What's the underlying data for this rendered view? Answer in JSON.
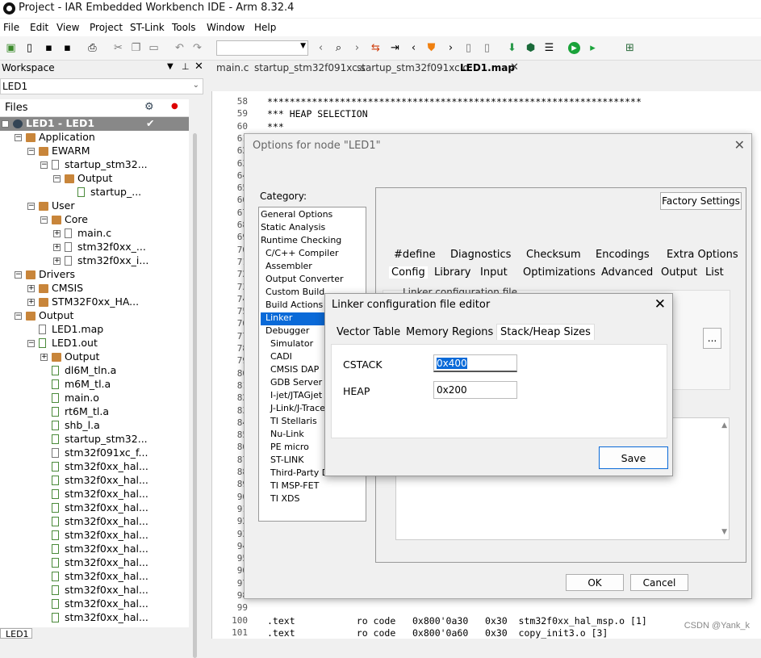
{
  "app": {
    "title": "Project - IAR Embedded Workbench IDE - Arm 8.32.4"
  },
  "menu": [
    "File",
    "Edit",
    "View",
    "Project",
    "ST-Link",
    "Tools",
    "Window",
    "Help"
  ],
  "workspace": {
    "header": "Workspace",
    "combo": "LED1",
    "files_header": "Files",
    "bottom_tab": "LED1",
    "tree": [
      {
        "label": "LED1 - LED1",
        "depth": 0,
        "kind": "project",
        "exp": "−"
      },
      {
        "label": "Application",
        "depth": 1,
        "kind": "folder",
        "exp": "−"
      },
      {
        "label": "EWARM",
        "depth": 2,
        "kind": "folder",
        "exp": "−"
      },
      {
        "label": "startup_stm32...",
        "depth": 3,
        "kind": "filegray",
        "exp": "−"
      },
      {
        "label": "Output",
        "depth": 4,
        "kind": "folder",
        "exp": "−"
      },
      {
        "label": "startup_...",
        "depth": 5,
        "kind": "file",
        "exp": ""
      },
      {
        "label": "User",
        "depth": 2,
        "kind": "folder",
        "exp": "−"
      },
      {
        "label": "Core",
        "depth": 3,
        "kind": "folder",
        "exp": "−"
      },
      {
        "label": "main.c",
        "depth": 4,
        "kind": "filegray",
        "exp": "+"
      },
      {
        "label": "stm32f0xx_...",
        "depth": 4,
        "kind": "filegray",
        "exp": "+"
      },
      {
        "label": "stm32f0xx_i...",
        "depth": 4,
        "kind": "filegray",
        "exp": "+"
      },
      {
        "label": "Drivers",
        "depth": 1,
        "kind": "folder",
        "exp": "−"
      },
      {
        "label": "CMSIS",
        "depth": 2,
        "kind": "folder",
        "exp": "+"
      },
      {
        "label": "STM32F0xx_HA...",
        "depth": 2,
        "kind": "folder",
        "exp": "+"
      },
      {
        "label": "Output",
        "depth": 1,
        "kind": "folder",
        "exp": "−"
      },
      {
        "label": "LED1.map",
        "depth": 2,
        "kind": "filegray",
        "exp": ""
      },
      {
        "label": "LED1.out",
        "depth": 2,
        "kind": "file",
        "exp": "−"
      },
      {
        "label": "Output",
        "depth": 3,
        "kind": "folder",
        "exp": "+"
      },
      {
        "label": "dl6M_tln.a",
        "depth": 3,
        "kind": "file",
        "exp": ""
      },
      {
        "label": "m6M_tl.a",
        "depth": 3,
        "kind": "file",
        "exp": ""
      },
      {
        "label": "main.o",
        "depth": 3,
        "kind": "file",
        "exp": ""
      },
      {
        "label": "rt6M_tl.a",
        "depth": 3,
        "kind": "file",
        "exp": ""
      },
      {
        "label": "shb_l.a",
        "depth": 3,
        "kind": "file",
        "exp": ""
      },
      {
        "label": "startup_stm32...",
        "depth": 3,
        "kind": "file",
        "exp": ""
      },
      {
        "label": "stm32f091xc_f...",
        "depth": 3,
        "kind": "filegray",
        "exp": ""
      },
      {
        "label": "stm32f0xx_hal...",
        "depth": 3,
        "kind": "file",
        "exp": ""
      },
      {
        "label": "stm32f0xx_hal...",
        "depth": 3,
        "kind": "file",
        "exp": ""
      },
      {
        "label": "stm32f0xx_hal...",
        "depth": 3,
        "kind": "file",
        "exp": ""
      },
      {
        "label": "stm32f0xx_hal...",
        "depth": 3,
        "kind": "file",
        "exp": ""
      },
      {
        "label": "stm32f0xx_hal...",
        "depth": 3,
        "kind": "file",
        "exp": ""
      },
      {
        "label": "stm32f0xx_hal...",
        "depth": 3,
        "kind": "file",
        "exp": ""
      },
      {
        "label": "stm32f0xx_hal...",
        "depth": 3,
        "kind": "file",
        "exp": ""
      },
      {
        "label": "stm32f0xx_hal...",
        "depth": 3,
        "kind": "file",
        "exp": ""
      },
      {
        "label": "stm32f0xx_hal...",
        "depth": 3,
        "kind": "file",
        "exp": ""
      },
      {
        "label": "stm32f0xx_hal...",
        "depth": 3,
        "kind": "file",
        "exp": ""
      },
      {
        "label": "stm32f0xx_hal...",
        "depth": 3,
        "kind": "file",
        "exp": ""
      },
      {
        "label": "stm32f0xx_hal...",
        "depth": 3,
        "kind": "file",
        "exp": ""
      }
    ]
  },
  "editor": {
    "tabs": [
      "main.c",
      "startup_stm32f091xc.s",
      "startup_stm32f091xc.o",
      "LED1.map"
    ],
    "active_tab": "LED1.map",
    "lines": [
      {
        "n": "58",
        "t": "*******************************************************************"
      },
      {
        "n": "59",
        "t": "*** HEAP SELECTION"
      },
      {
        "n": "60",
        "t": "***"
      },
      {
        "n": "61",
        "t": ""
      },
      {
        "n": "62",
        "t": ""
      },
      {
        "n": "63",
        "t": ""
      },
      {
        "n": "64",
        "t": ""
      },
      {
        "n": "65",
        "t": ""
      },
      {
        "n": "66",
        "t": ""
      },
      {
        "n": "67",
        "t": ""
      },
      {
        "n": "68",
        "t": ""
      },
      {
        "n": "69",
        "t": ""
      },
      {
        "n": "70",
        "t": ""
      },
      {
        "n": "71",
        "t": ""
      },
      {
        "n": "72",
        "t": ""
      },
      {
        "n": "73",
        "t": ""
      },
      {
        "n": "74",
        "t": ""
      },
      {
        "n": "75",
        "t": ""
      },
      {
        "n": "76",
        "t": ""
      },
      {
        "n": "77",
        "t": ""
      },
      {
        "n": "78",
        "t": ""
      },
      {
        "n": "79",
        "t": ""
      },
      {
        "n": "80",
        "t": ""
      },
      {
        "n": "81",
        "t": ""
      },
      {
        "n": "82",
        "t": ""
      },
      {
        "n": "83",
        "t": ""
      },
      {
        "n": "84",
        "t": ""
      },
      {
        "n": "85",
        "t": ""
      },
      {
        "n": "86",
        "t": ""
      },
      {
        "n": "87",
        "t": ""
      },
      {
        "n": "88",
        "t": ""
      },
      {
        "n": "89",
        "t": ""
      },
      {
        "n": "90",
        "t": ""
      },
      {
        "n": "91",
        "t": ""
      },
      {
        "n": "92",
        "t": ""
      },
      {
        "n": "93",
        "t": ""
      },
      {
        "n": "94",
        "t": ""
      },
      {
        "n": "95",
        "t": ""
      },
      {
        "n": "96",
        "t": ""
      },
      {
        "n": "97",
        "t": ""
      },
      {
        "n": "98",
        "t": ""
      },
      {
        "n": "99",
        "t": ""
      },
      {
        "n": "100",
        "t": ".text           ro code   0x800'0a30   0x30  stm32f0xx_hal_msp.o [1]"
      },
      {
        "n": "101",
        "t": ".text           ro code   0x800'0a60   0x30  copy_init3.o [3]"
      }
    ],
    "watermark": "CSDN @Yank_k"
  },
  "options_dialog": {
    "title": "Options for node \"LED1\"",
    "category_label": "Category:",
    "categories": [
      {
        "label": "General Options",
        "indent": 0
      },
      {
        "label": "Static Analysis",
        "indent": 0
      },
      {
        "label": "Runtime Checking",
        "indent": 0
      },
      {
        "label": "C/C++ Compiler",
        "indent": 1
      },
      {
        "label": "Assembler",
        "indent": 1
      },
      {
        "label": "Output Converter",
        "indent": 1
      },
      {
        "label": "Custom Build",
        "indent": 1
      },
      {
        "label": "Build Actions",
        "indent": 1
      },
      {
        "label": "Linker",
        "indent": 1,
        "selected": true
      },
      {
        "label": "Debugger",
        "indent": 1
      },
      {
        "label": "Simulator",
        "indent": 2
      },
      {
        "label": "CADI",
        "indent": 2
      },
      {
        "label": "CMSIS DAP",
        "indent": 2
      },
      {
        "label": "GDB Server",
        "indent": 2
      },
      {
        "label": "I-jet/JTAGjet",
        "indent": 2
      },
      {
        "label": "J-Link/J-Trace",
        "indent": 2
      },
      {
        "label": "TI Stellaris",
        "indent": 2
      },
      {
        "label": "Nu-Link",
        "indent": 2
      },
      {
        "label": "PE micro",
        "indent": 2
      },
      {
        "label": "ST-LINK",
        "indent": 2
      },
      {
        "label": "Third-Party Dr...",
        "indent": 2
      },
      {
        "label": "TI MSP-FET",
        "indent": 2
      },
      {
        "label": "TI XDS",
        "indent": 2
      }
    ],
    "factory_settings": "Factory Settings",
    "tabs_row1": [
      "#define",
      "Diagnostics",
      "Checksum",
      "Encodings",
      "Extra Options"
    ],
    "tabs_row2": [
      "Config",
      "Library",
      "Input",
      "Optimizations",
      "Advanced",
      "Output",
      "List"
    ],
    "active_tab": "Config",
    "config_group": "Linker configuration file",
    "browse": "...",
    "ok": "OK",
    "cancel": "Cancel"
  },
  "linker_dialog": {
    "title": "Linker configuration file editor",
    "tabs": [
      "Vector Table",
      "Memory Regions",
      "Stack/Heap Sizes"
    ],
    "active_tab": "Stack/Heap Sizes",
    "cstack_label": "CSTACK",
    "cstack_value": "0x400",
    "heap_label": "HEAP",
    "heap_value": "0x200",
    "save": "Save"
  }
}
